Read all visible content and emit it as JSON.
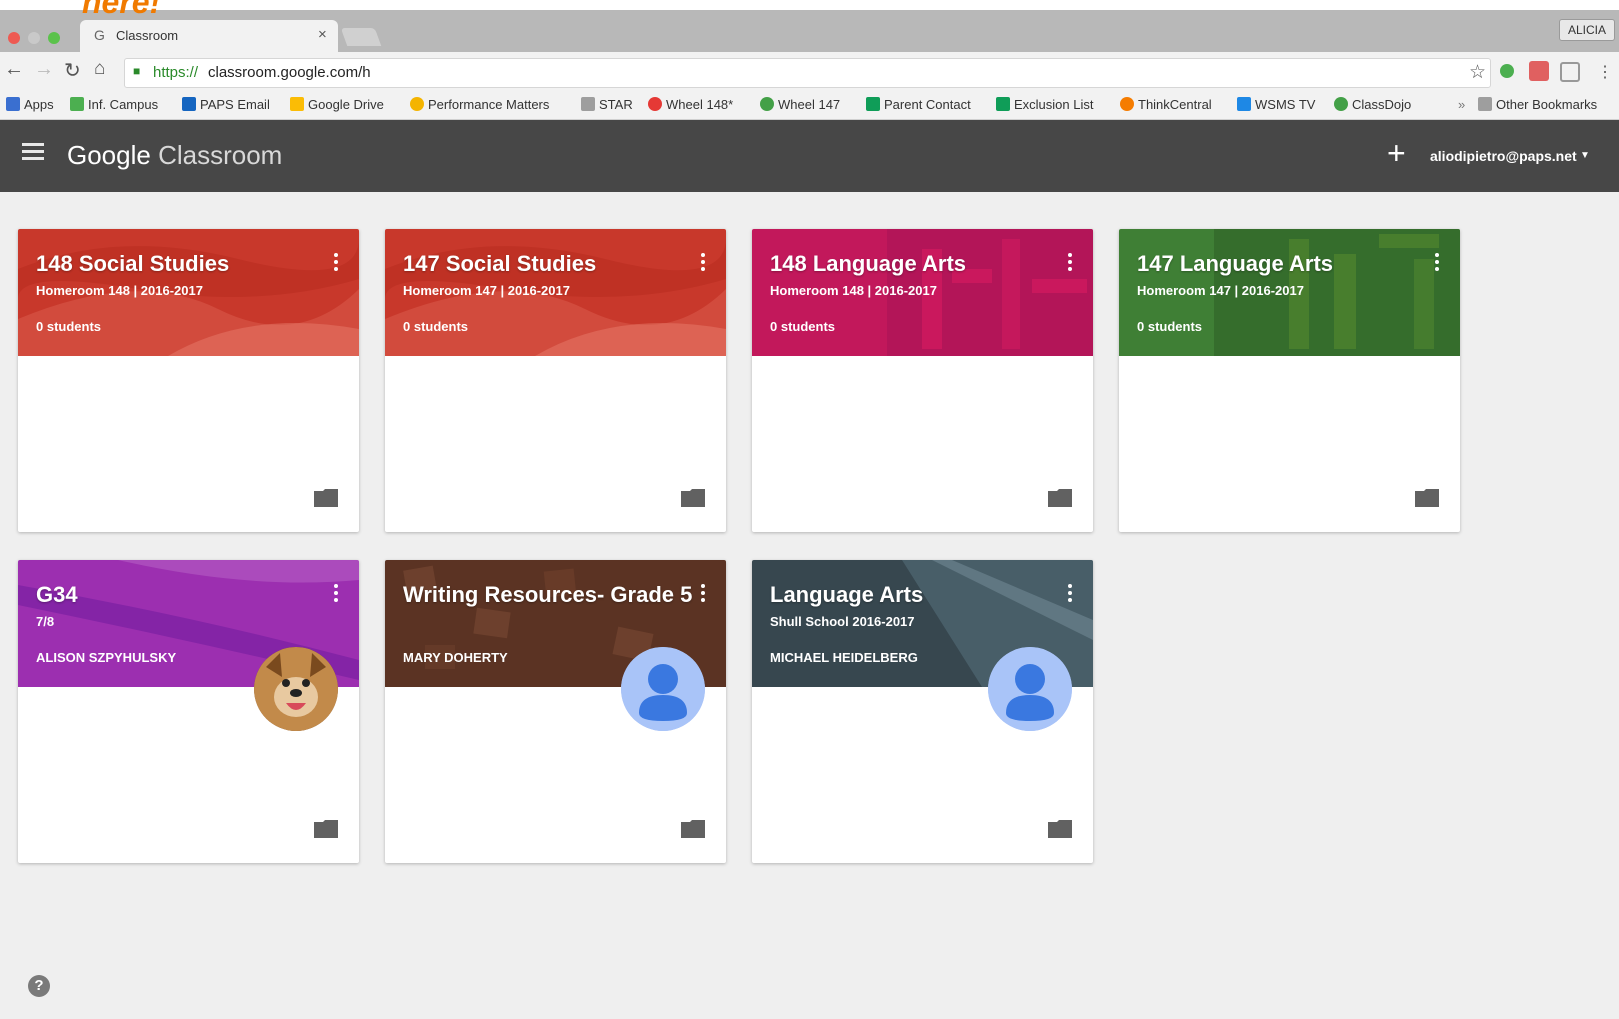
{
  "overlay": {
    "text": "here!"
  },
  "browser": {
    "tab_title": "Classroom",
    "tab_close": "×",
    "profile": "ALICIA",
    "url_scheme": "https://",
    "url_rest": "classroom.google.com/h",
    "bookmarks": [
      {
        "label": "Apps",
        "color": "#3a6fd0"
      },
      {
        "label": "Inf. Campus",
        "color": "#4caf50"
      },
      {
        "label": "PAPS Email",
        "color": "#1565c0"
      },
      {
        "label": "Google Drive",
        "color": "#fbbc05"
      },
      {
        "label": "Performance Matters",
        "color": "#f4b400"
      },
      {
        "label": "STAR",
        "color": "#9e9e9e"
      },
      {
        "label": "Wheel 148*",
        "color": "#e53935"
      },
      {
        "label": "Wheel 147",
        "color": "#43a047"
      },
      {
        "label": "Parent Contact",
        "color": "#0f9d58"
      },
      {
        "label": "Exclusion List",
        "color": "#0f9d58"
      },
      {
        "label": "ThinkCentral",
        "color": "#f57c00"
      },
      {
        "label": "WSMS TV",
        "color": "#1e88e5"
      },
      {
        "label": "ClassDojo",
        "color": "#43a047"
      },
      {
        "label": "»",
        "color": ""
      },
      {
        "label": "Other Bookmarks",
        "color": "#9e9e9e"
      }
    ]
  },
  "app": {
    "logo_google": "Google",
    "logo_classroom": " Classroom",
    "account": "aliodipietro@paps.net",
    "plus": "+"
  },
  "cards": [
    {
      "title": "148 Social Studies",
      "subtitle": "Homeroom 148 | 2016-2017",
      "meta": "0 students",
      "color": "#c8382b",
      "theme": "flag"
    },
    {
      "title": "147 Social Studies",
      "subtitle": "Homeroom 147 | 2016-2017",
      "meta": "0 students",
      "color": "#c8382b",
      "theme": "flag"
    },
    {
      "title": "148 Language Arts",
      "subtitle": "Homeroom 148 | 2016-2017",
      "meta": "0 students",
      "color": "#c2185b",
      "theme": "words"
    },
    {
      "title": "147 Language Arts",
      "subtitle": "Homeroom 147 | 2016-2017",
      "meta": "0 students",
      "color": "#3f7f35",
      "theme": "words"
    },
    {
      "title": "G34",
      "subtitle": "7/8",
      "meta": "ALISON SZPYHULSKY",
      "color": "#9c2fb0",
      "theme": "swoosh",
      "avatar": "dog"
    },
    {
      "title": "Writing Resources- Grade 5",
      "subtitle": "",
      "meta": "MARY DOHERTY",
      "color": "#5b3323",
      "theme": "letters",
      "avatar": "person"
    },
    {
      "title": "Language Arts",
      "subtitle": "Shull School 2016-2017",
      "meta": "MICHAEL HEIDELBERG",
      "color": "#37474f",
      "theme": "book",
      "avatar": "person"
    }
  ],
  "help": "?"
}
